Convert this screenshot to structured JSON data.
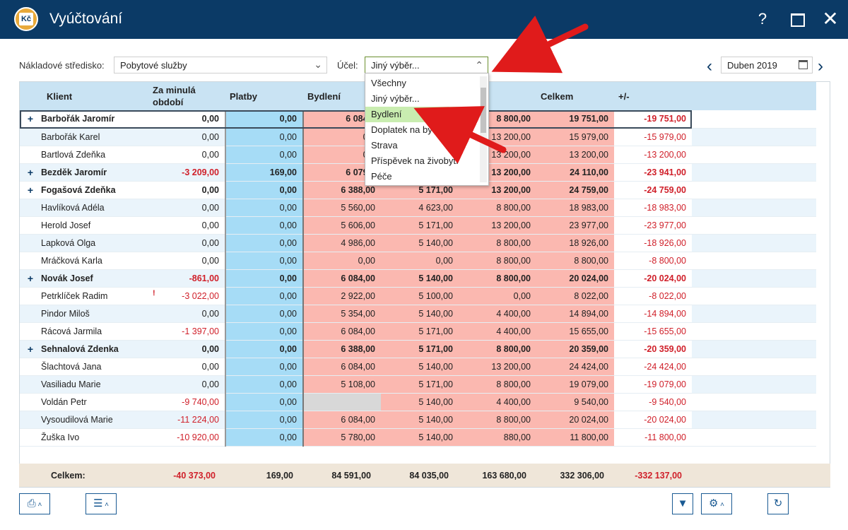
{
  "window": {
    "title": "Vyúčtování",
    "icon_text": "Kč",
    "help": "?",
    "close": "✕"
  },
  "filters": {
    "center_label": "Nákladové středisko:",
    "center_value": "Pobytové služby",
    "purpose_label": "Účel:",
    "purpose_value": "Jiný výběr...",
    "month": "Duben 2019"
  },
  "dropdown": {
    "items": [
      "Všechny",
      "Jiný výběr...",
      "Bydlení",
      "Doplatek na bydlení",
      "Strava",
      "Příspěvek na živobytí",
      "Péče"
    ],
    "highlighted": "Bydlení"
  },
  "table": {
    "columns": [
      "",
      "Klient",
      "Za minulá období",
      "Platby",
      "Bydlení",
      "",
      "",
      "Celkem",
      "+/-"
    ],
    "rows": [
      {
        "group": true,
        "name": "Barbořák Jaromír",
        "prev": "0,00",
        "platby": "0,00",
        "bydleni": "6 084,0",
        "col5": "",
        "col6": "8 800,00",
        "celkem": "19 751,00",
        "diff": "-19 751,00"
      },
      {
        "group": false,
        "name": "Barbořák Karel",
        "prev": "0,00",
        "platby": "0,00",
        "bydleni": "0,0",
        "col5": "",
        "col6": "13 200,00",
        "celkem": "15 979,00",
        "diff": "-15 979,00"
      },
      {
        "group": false,
        "name": "Bartlová Zdeňka",
        "prev": "0,00",
        "platby": "0,00",
        "bydleni": "0,0",
        "col5": "",
        "col6": "13 200,00",
        "celkem": "13 200,00",
        "diff": "-13 200,00"
      },
      {
        "group": true,
        "name": "Bezděk Jaromír",
        "prev": "-3 209,00",
        "platby": "169,00",
        "bydleni": "6 079,0",
        "col5": "",
        "col6": "13 200,00",
        "celkem": "24 110,00",
        "diff": "-23 941,00"
      },
      {
        "group": true,
        "name": "Fogašová Zdeňka",
        "prev": "0,00",
        "platby": "0,00",
        "bydleni": "6 388,00",
        "col5": "5 171,00",
        "col6": "13 200,00",
        "celkem": "24 759,00",
        "diff": "-24 759,00"
      },
      {
        "group": false,
        "name": "Havlíková Adéla",
        "prev": "0,00",
        "platby": "0,00",
        "bydleni": "5 560,00",
        "col5": "4 623,00",
        "col6": "8 800,00",
        "celkem": "18 983,00",
        "diff": "-18 983,00"
      },
      {
        "group": false,
        "name": "Herold Josef",
        "prev": "0,00",
        "platby": "0,00",
        "bydleni": "5 606,00",
        "col5": "5 171,00",
        "col6": "13 200,00",
        "celkem": "23 977,00",
        "diff": "-23 977,00"
      },
      {
        "group": false,
        "name": "Lapková Olga",
        "prev": "0,00",
        "platby": "0,00",
        "bydleni": "4 986,00",
        "col5": "5 140,00",
        "col6": "8 800,00",
        "celkem": "18 926,00",
        "diff": "-18 926,00"
      },
      {
        "group": false,
        "name": "Mráčková Karla",
        "prev": "0,00",
        "platby": "0,00",
        "bydleni": "0,00",
        "col5": "0,00",
        "col6": "8 800,00",
        "celkem": "8 800,00",
        "diff": "-8 800,00"
      },
      {
        "group": true,
        "name": "Novák Josef",
        "prev": "-861,00",
        "platby": "0,00",
        "bydleni": "6 084,00",
        "col5": "5 140,00",
        "col6": "8 800,00",
        "celkem": "20 024,00",
        "diff": "-20 024,00"
      },
      {
        "group": false,
        "name": "Petrklíček Radim",
        "prev": "-3 022,00",
        "platby": "0,00",
        "bydleni": "2 922,00",
        "col5": "5 100,00",
        "col6": "0,00",
        "celkem": "8 022,00",
        "diff": "-8 022,00"
      },
      {
        "group": false,
        "name": "Pindor Miloš",
        "prev": "0,00",
        "platby": "0,00",
        "bydleni": "5 354,00",
        "col5": "5 140,00",
        "col6": "4 400,00",
        "celkem": "14 894,00",
        "diff": "-14 894,00"
      },
      {
        "group": false,
        "name": "Rácová Jarmila",
        "prev": "-1 397,00",
        "platby": "0,00",
        "bydleni": "6 084,00",
        "col5": "5 171,00",
        "col6": "4 400,00",
        "celkem": "15 655,00",
        "diff": "-15 655,00"
      },
      {
        "group": true,
        "name": "Sehnalová Zdenka",
        "prev": "0,00",
        "platby": "0,00",
        "bydleni": "6 388,00",
        "col5": "5 171,00",
        "col6": "8 800,00",
        "celkem": "20 359,00",
        "diff": "-20 359,00"
      },
      {
        "group": false,
        "name": "Šlachtová Jana",
        "prev": "0,00",
        "platby": "0,00",
        "bydleni": "6 084,00",
        "col5": "5 140,00",
        "col6": "13 200,00",
        "celkem": "24 424,00",
        "diff": "-24 424,00"
      },
      {
        "group": false,
        "name": "Vasiliadu Marie",
        "prev": "0,00",
        "platby": "0,00",
        "bydleni": "5 108,00",
        "col5": "5 171,00",
        "col6": "8 800,00",
        "celkem": "19 079,00",
        "diff": "-19 079,00"
      },
      {
        "group": false,
        "name": "Voldán Petr",
        "prev": "-9 740,00",
        "platby": "0,00",
        "bydleni": "",
        "col5": "5 140,00",
        "col6": "4 400,00",
        "celkem": "9 540,00",
        "diff": "-9 540,00"
      },
      {
        "group": false,
        "name": "Vysoudilová Marie",
        "prev": "-11 224,00",
        "platby": "0,00",
        "bydleni": "6 084,00",
        "col5": "5 140,00",
        "col6": "8 800,00",
        "celkem": "20 024,00",
        "diff": "-20 024,00"
      },
      {
        "group": false,
        "name": "Žuška Ivo",
        "prev": "-10 920,00",
        "platby": "0,00",
        "bydleni": "5 780,00",
        "col5": "5 140,00",
        "col6": "880,00",
        "celkem": "11 800,00",
        "diff": "-11 800,00"
      }
    ],
    "totals": {
      "label": "Celkem:",
      "prev": "-40 373,00",
      "platby": "169,00",
      "bydleni": "84 591,00",
      "col5": "84 035,00",
      "col6": "163 680,00",
      "celkem": "332 306,00",
      "diff": "-332 137,00"
    }
  },
  "colors": {
    "titlebar": "#0b3a66",
    "header": "#c9e3f3",
    "payments": "#a6dcf6",
    "costs": "#fbb8b0",
    "negative": "#d0202a",
    "highlight": "#c9edb0",
    "arrow": "#e01b1b"
  },
  "icons": [
    "print-icon",
    "menu-icon",
    "filter-icon",
    "gear-icon",
    "refresh-icon",
    "calendar-icon"
  ]
}
